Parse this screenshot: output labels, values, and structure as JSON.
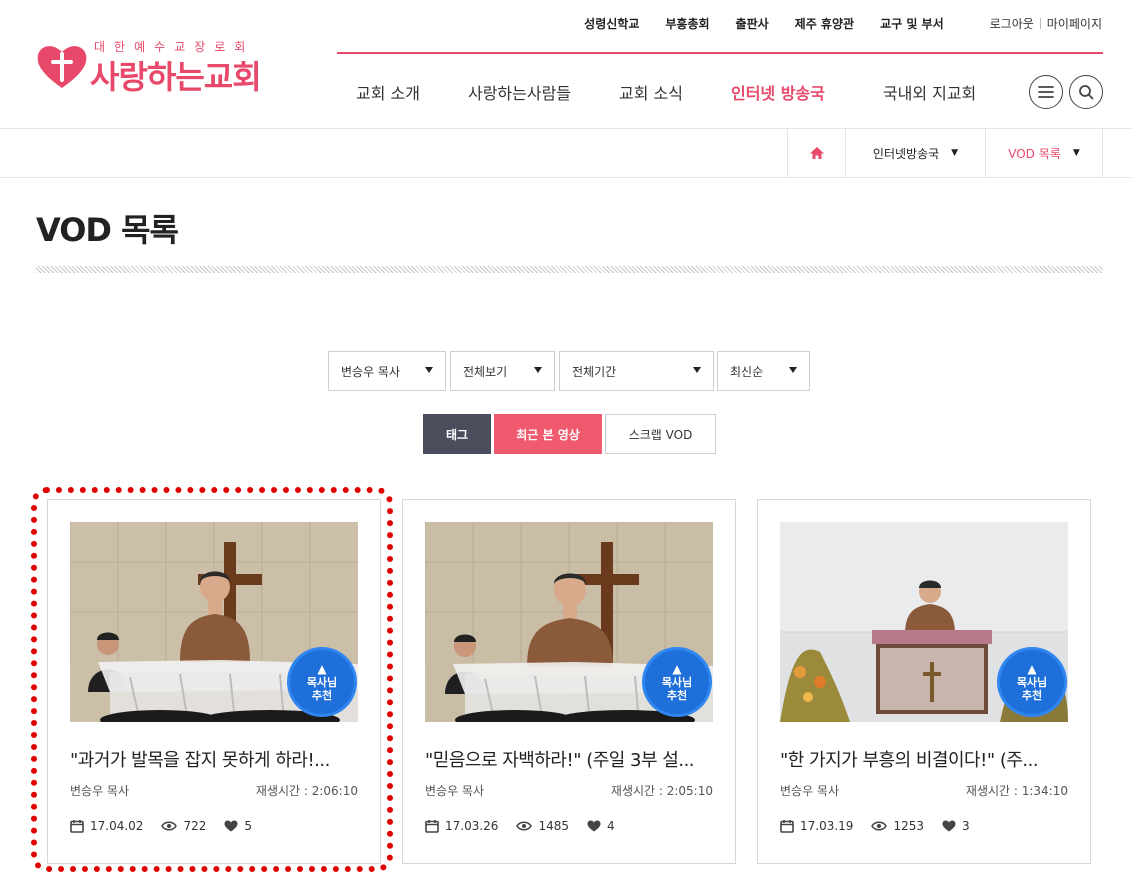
{
  "logo": {
    "small": "대한예수교장로회",
    "main": "사랑하는교회"
  },
  "util_nav": [
    "성령신학교",
    "부흥총회",
    "출판사",
    "제주 휴양관",
    "교구 및 부서"
  ],
  "account": {
    "logout": "로그아웃",
    "mypage": "마이페이지"
  },
  "gnb": [
    {
      "label": "교회 소개",
      "active": false
    },
    {
      "label": "사랑하는사람들",
      "active": false
    },
    {
      "label": "교회 소식",
      "active": false
    },
    {
      "label": "인터넷 방송국",
      "active": true
    },
    {
      "label": "국내외 지교회",
      "active": false
    }
  ],
  "breadcrumb": {
    "level1": "인터넷방송국",
    "level2": "VOD 목록"
  },
  "page_title": "VOD 목록",
  "filters": {
    "pastor": "변승우 목사",
    "view": "전체보기",
    "period": "전체기간",
    "sort": "최신순"
  },
  "tabs": {
    "tag": "태그",
    "recent": "최근 본 영상",
    "scrap": "스크랩 VOD"
  },
  "badge": {
    "line1": "목사님",
    "line2": "추천"
  },
  "videos": [
    {
      "title": "\"과거가 발목을 잡지 못하게 하라!...",
      "author": "변승우 목사",
      "runtime": "재생시간 : 2:06:10",
      "date": "17.04.02",
      "views": "722",
      "likes": "5"
    },
    {
      "title": "\"믿음으로 자백하라!\" (주일 3부 설...",
      "author": "변승우 목사",
      "runtime": "재생시간 : 2:05:10",
      "date": "17.03.26",
      "views": "1485",
      "likes": "4"
    },
    {
      "title": "\"한 가지가 부흥의 비결이다!\" (주...",
      "author": "변승우 목사",
      "runtime": "재생시간 : 1:34:10",
      "date": "17.03.19",
      "views": "1253",
      "likes": "3"
    }
  ],
  "colors": {
    "brand": "#e8486a",
    "tab_dark": "#4a4e5c",
    "tab_active": "#ef5a6f",
    "badge": "#1e6fd9",
    "highlight": "#e00000"
  },
  "icons": [
    "menu-icon",
    "search-icon",
    "home-icon",
    "calendar-icon",
    "eye-icon",
    "heart-icon",
    "logo-heart-cross-icon"
  ]
}
